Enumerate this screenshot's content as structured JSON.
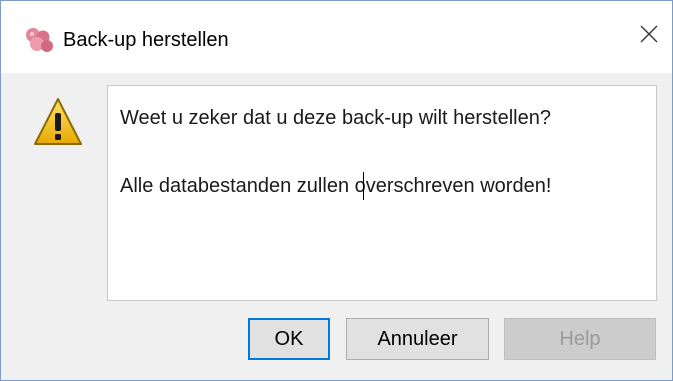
{
  "window": {
    "title": "Back-up herstellen",
    "icon": "app-logo-icon",
    "close_icon": "close-icon"
  },
  "message": {
    "icon": "warning-icon",
    "line1": "Weet u zeker dat u deze back-up wilt herstellen?",
    "line2": "Alle databestanden zullen overschreven worden!"
  },
  "buttons": {
    "ok_label": "OK",
    "cancel_label": "Annuleer",
    "help_label": "Help",
    "help_enabled": false
  },
  "colors": {
    "focus_border": "#0078d7",
    "warning_yellow": "#f5c300",
    "logo_pink": "#e88a9a"
  }
}
